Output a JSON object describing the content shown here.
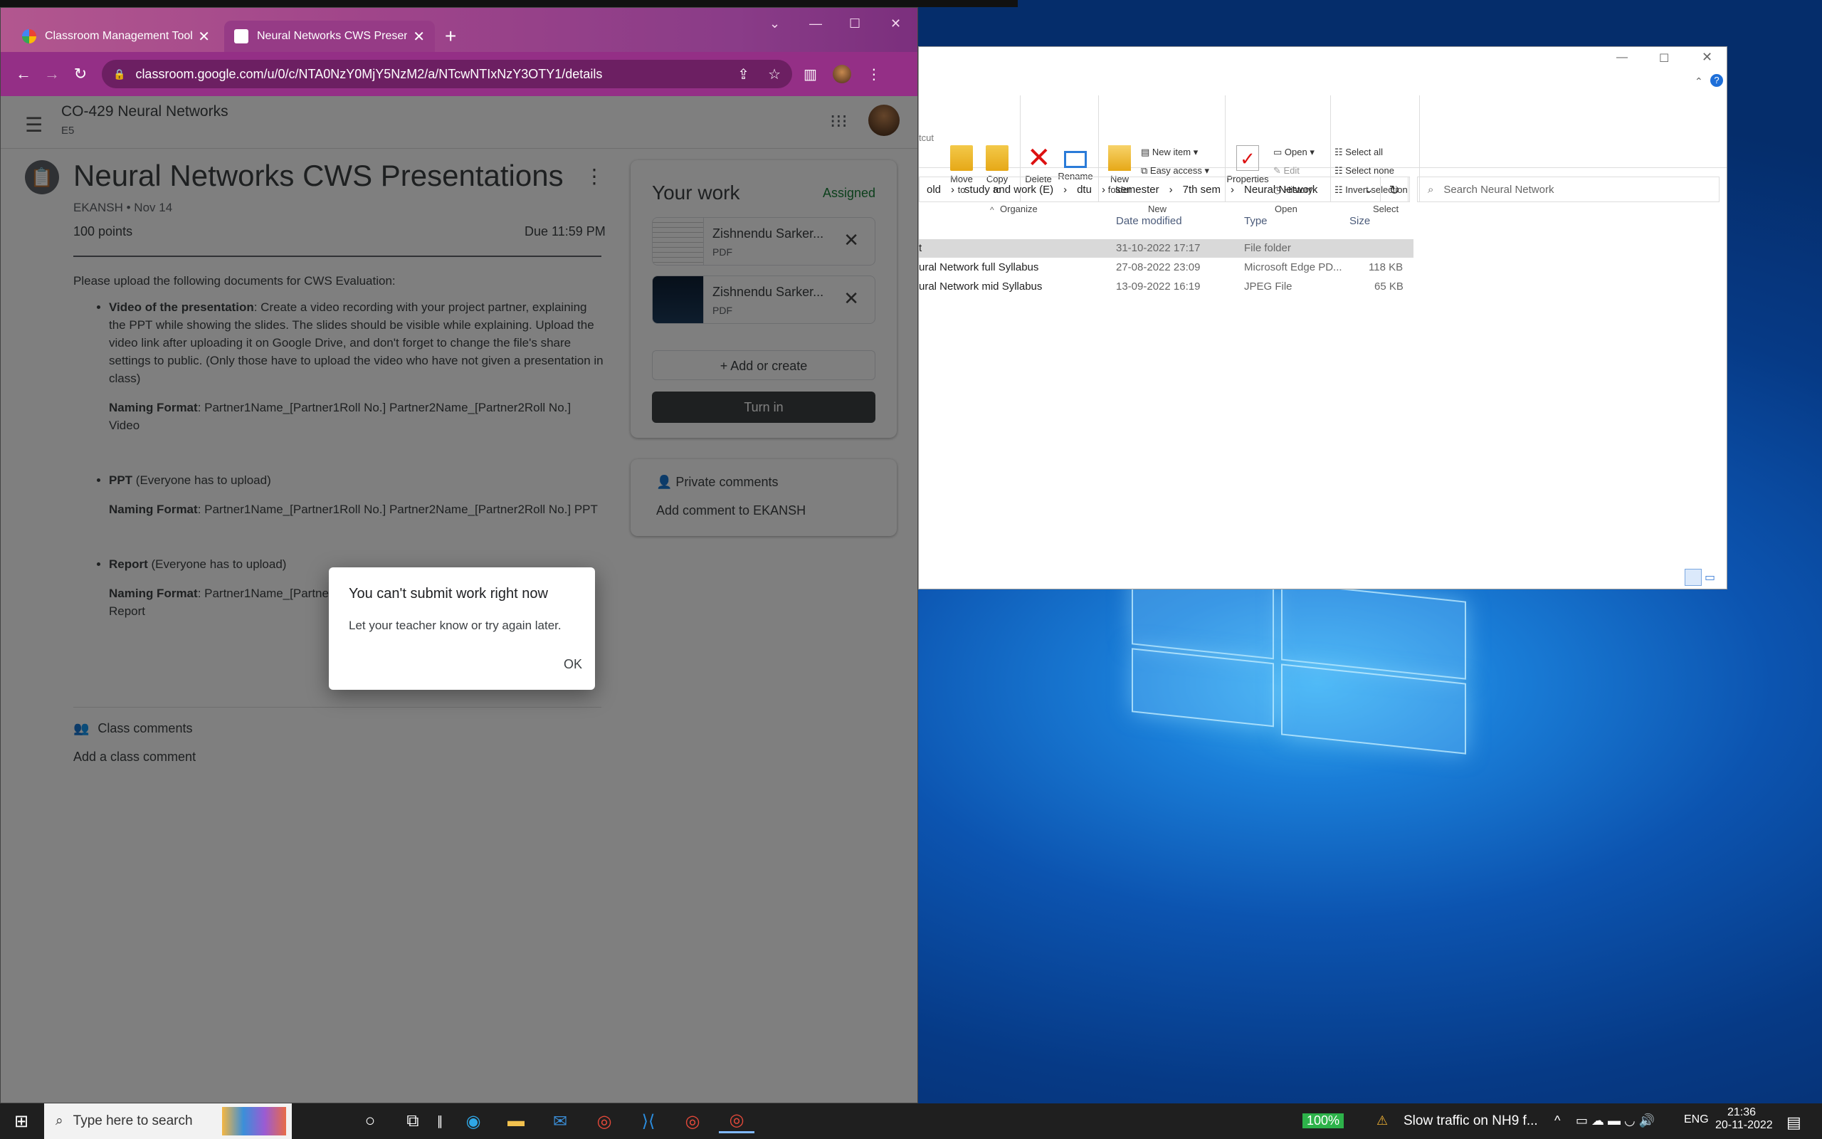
{
  "browser": {
    "tabs": [
      {
        "label": "Classroom Management Tools &",
        "active": false
      },
      {
        "label": "Neural Networks CWS Presentati",
        "active": true
      }
    ],
    "url": "classroom.google.com/u/0/c/NTA0NzY0MjY5NzM2/a/NTcwNTIxNzY3OTY1/details"
  },
  "classroom": {
    "class_name": "CO-429 Neural Networks",
    "class_section": "E5",
    "assignment": {
      "title": "Neural Networks CWS Presentations",
      "meta": "EKANSH • Nov 14",
      "points": "100 points",
      "due": "Due 11:59 PM",
      "intro": "Please upload the following documents for CWS Evaluation:",
      "items": [
        {
          "heading": "Video of the presentation",
          "text": ": Create a video recording with your project partner, explaining the PPT while showing the slides. The slides should be visible while explaining. Upload the video link after uploading it on Google Drive, and don't forget to change the file's share settings to public. (Only those have to upload the video who have not given a presentation in class)",
          "format_label": "Naming Format",
          "format": ": Partner1Name_[Partner1Roll No.] Partner2Name_[Partner2Roll No.] Video"
        },
        {
          "heading": "PPT",
          "text": " (Everyone has to upload)",
          "format_label": "Naming Format",
          "format": ": Partner1Name_[Partner1Roll No.] Partner2Name_[Partner2Roll No.] PPT"
        },
        {
          "heading": "Report",
          "text": " (Everyone has to upload)",
          "format_label": "Naming Format",
          "format": ": Partner1Name_[Partner1Roll No.] Partner2Name_[Partner2Roll No.] Report"
        }
      ]
    },
    "class_comments": "Class comments",
    "add_class_comment": "Add a class comment",
    "your_work": {
      "title": "Your work",
      "status": "Assigned",
      "attachments": [
        {
          "name": "Zishnendu Sarker...",
          "type": "PDF"
        },
        {
          "name": "Zishnendu Sarker...",
          "type": "PDF"
        }
      ],
      "add_or_create": "Add or create",
      "turn_in": "Turn in"
    },
    "private_comments": {
      "title": "Private comments",
      "add": "Add comment to EKANSH"
    },
    "dialog": {
      "title": "You can't submit work right now",
      "message": "Let your teacher know or try again later.",
      "ok": "OK"
    }
  },
  "explorer": {
    "ribbon": {
      "shortcut_fragment": "tcut",
      "move_to": "Move\nto",
      "copy_to": "Copy\nto",
      "delete": "Delete",
      "rename": "Rename",
      "new_folder": "New\nfolder",
      "new_item": "New item",
      "easy_access": "Easy access",
      "properties": "Properties",
      "open": "Open",
      "edit": "Edit",
      "history": "History",
      "select_all": "Select all",
      "select_none": "Select none",
      "invert_selection": "Invert selection",
      "groups": [
        "Organize",
        "New",
        "Open",
        "Select"
      ]
    },
    "path": [
      "old",
      "study and work (E)",
      "dtu",
      "semester",
      "7th sem",
      "Neural Network"
    ],
    "search_placeholder": "Search Neural Network",
    "columns": [
      "Date modified",
      "Type",
      "Size"
    ],
    "rows": [
      {
        "name": "t",
        "date": "31-10-2022 17:17",
        "type": "File folder",
        "size": ""
      },
      {
        "name": "ural Network full Syllabus",
        "date": "27-08-2022 23:09",
        "type": "Microsoft Edge PD...",
        "size": "118 KB"
      },
      {
        "name": "ural Network mid Syllabus",
        "date": "13-09-2022 16:19",
        "type": "JPEG File",
        "size": "65 KB"
      }
    ]
  },
  "taskbar": {
    "search_placeholder": "Type here to search",
    "battery": "100%",
    "news": "Slow traffic on NH9 f...",
    "lang": "ENG",
    "time": "21:36",
    "date": "20-11-2022"
  },
  "colors": {
    "tabbar": "#a0458a",
    "toolbar": "#942f86",
    "assigned_green": "#188038",
    "turn_in": "#3c4043"
  }
}
